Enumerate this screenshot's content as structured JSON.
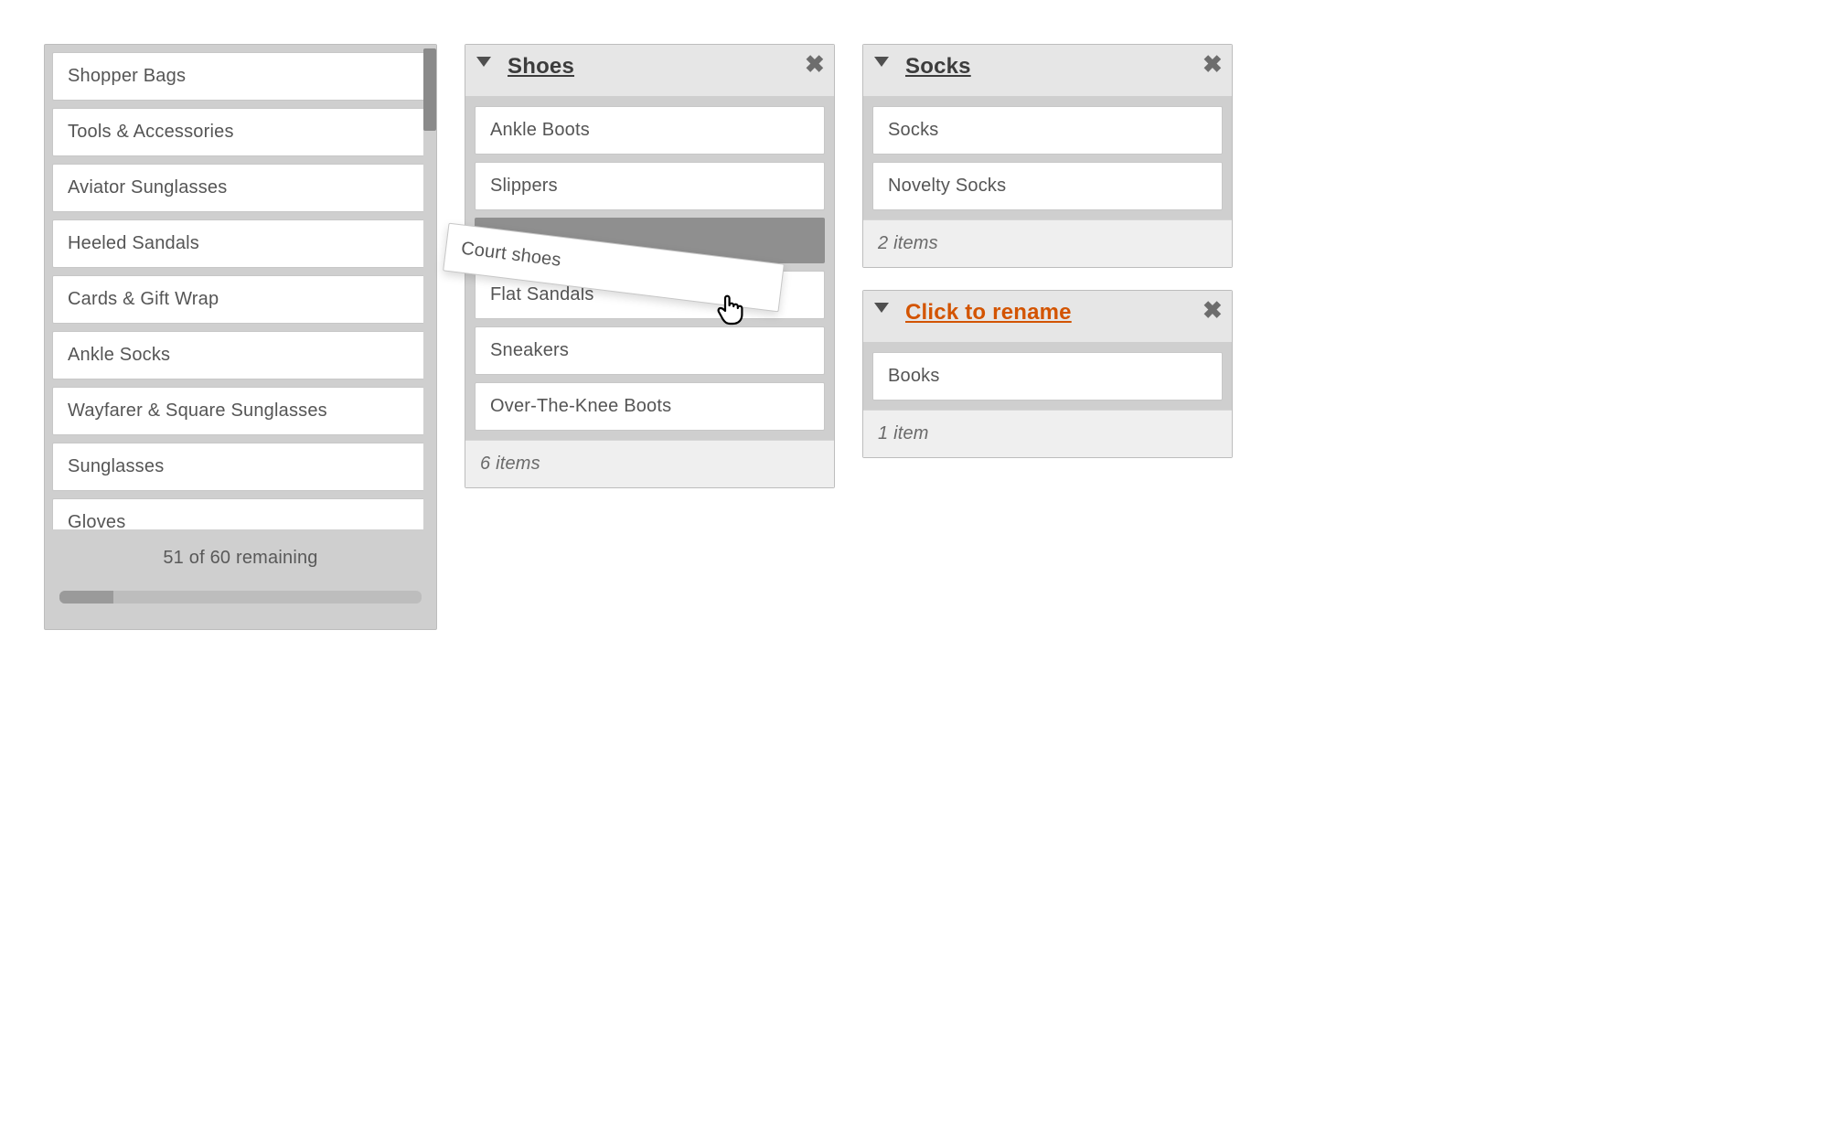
{
  "source": {
    "items": [
      "Shopper Bags",
      "Tools & Accessories",
      "Aviator Sunglasses",
      "Heeled Sandals",
      "Cards & Gift Wrap",
      "Ankle Socks",
      "Wayfarer & Square Sunglasses",
      "Sunglasses",
      "Gloves"
    ],
    "remaining_text": "51 of 60 remaining"
  },
  "dragged": {
    "label": "Court shoes"
  },
  "groups": [
    {
      "id": "shoes",
      "title": "Shoes",
      "rename": false,
      "items": [
        "Ankle Boots",
        "Slippers",
        "__placeholder__",
        "Flat Sandals",
        "Sneakers",
        "Over-The-Knee Boots"
      ],
      "count_text": "6 items"
    },
    {
      "id": "socks",
      "title": "Socks",
      "rename": false,
      "items": [
        "Socks",
        "Novelty Socks"
      ],
      "count_text": "2 items"
    },
    {
      "id": "new",
      "title": "Click to rename",
      "rename": true,
      "items": [
        "Books"
      ],
      "count_text": "1 item"
    }
  ]
}
